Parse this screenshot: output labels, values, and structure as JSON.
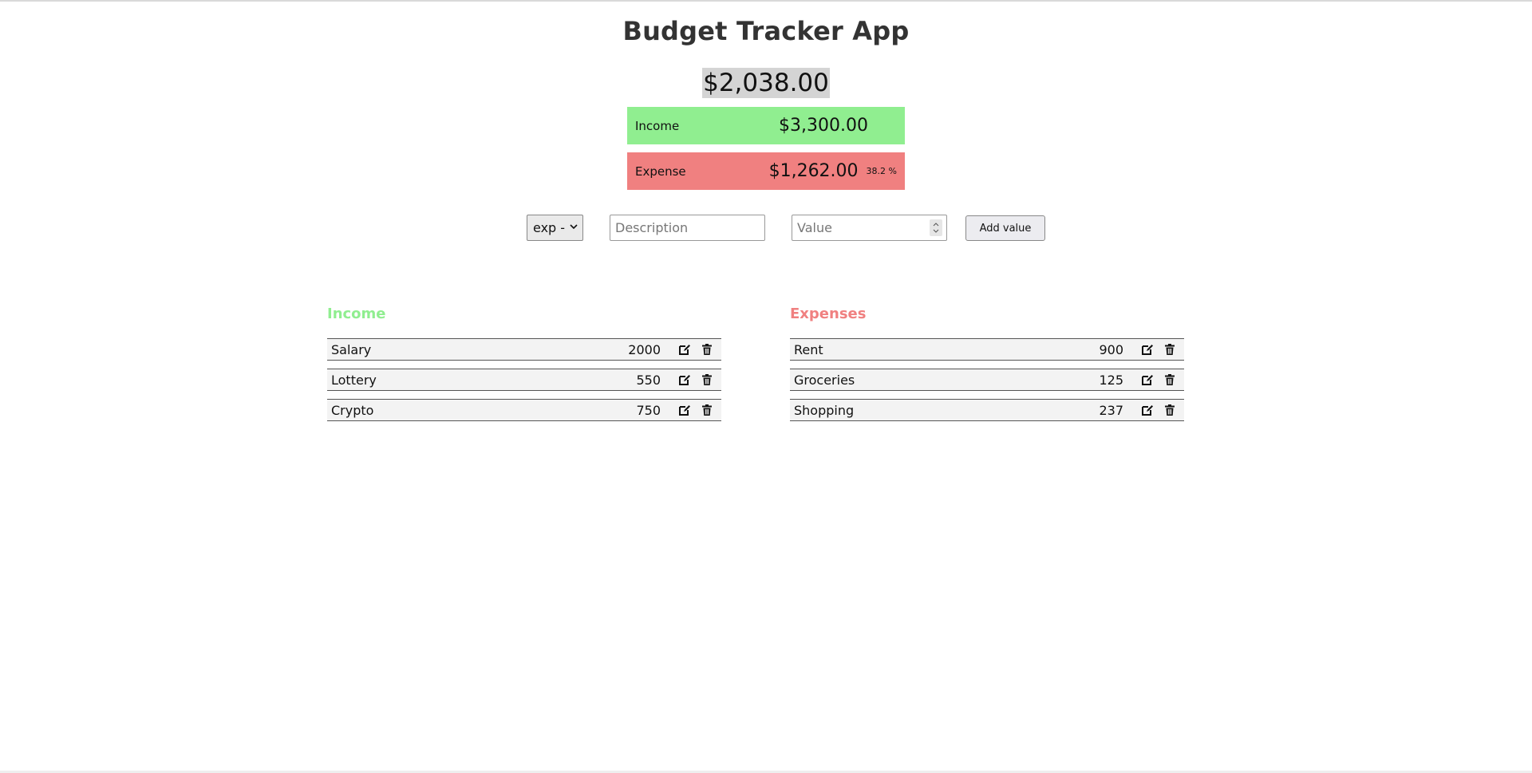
{
  "app": {
    "title": "Budget Tracker App"
  },
  "summary": {
    "balance": "$2,038.00",
    "income_label": "Income",
    "income_amount": "$3,300.00",
    "expense_label": "Expense",
    "expense_amount": "$1,262.00",
    "expense_percent": "38.2 %"
  },
  "form": {
    "type_value": "exp -",
    "description_placeholder": "Description",
    "value_placeholder": "Value",
    "add_label": "Add value"
  },
  "income": {
    "heading": "Income",
    "items": [
      {
        "description": "Salary",
        "value": "2000"
      },
      {
        "description": "Lottery",
        "value": "550"
      },
      {
        "description": "Crypto",
        "value": "750"
      }
    ]
  },
  "expenses": {
    "heading": "Expenses",
    "items": [
      {
        "description": "Rent",
        "value": "900"
      },
      {
        "description": "Groceries",
        "value": "125"
      },
      {
        "description": "Shopping",
        "value": "237"
      }
    ]
  },
  "colors": {
    "income": "#90ee90",
    "expense": "#f08080",
    "balance_highlight": "#d4d4d4"
  },
  "icons": {
    "edit": "edit-icon",
    "delete": "trash-icon",
    "select": "chevron-down-icon"
  }
}
